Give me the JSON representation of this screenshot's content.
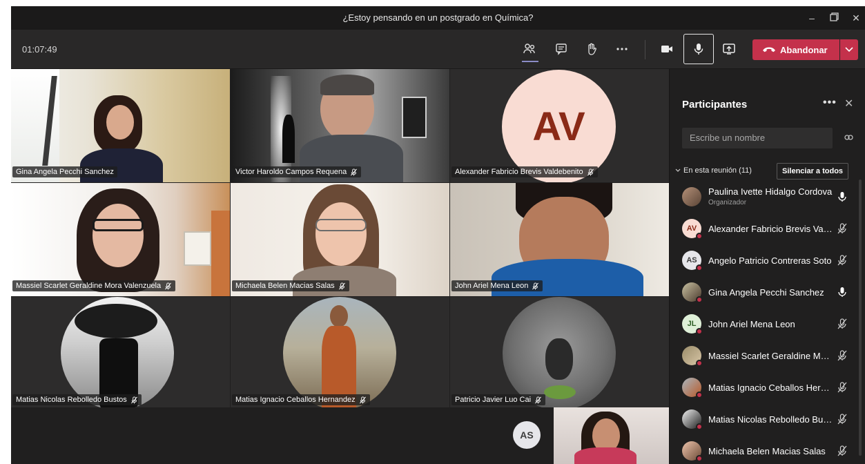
{
  "window": {
    "title": "¿Estoy pensando en un postgrado en Química?"
  },
  "toolbar": {
    "timer": "01:07:49",
    "leave_label": "Abandonar",
    "icons": [
      "people-icon",
      "chat-icon",
      "raise-hand-icon",
      "more-icon",
      "camera-icon",
      "microphone-icon",
      "share-screen-icon",
      "phone-hangup-icon",
      "chevron-down-icon"
    ]
  },
  "grid": {
    "tiles": [
      {
        "name": "Gina Angela Pecchi Sanchez",
        "muted": false
      },
      {
        "name": "Victor Haroldo Campos Requena",
        "muted": true
      },
      {
        "name": "Alexander Fabricio Brevis Valdebenito",
        "muted": true,
        "initials": "AV"
      },
      {
        "name": "Massiel Scarlet Geraldine Mora Valenzuela",
        "muted": true
      },
      {
        "name": "Michaela Belen Macias Salas",
        "muted": true
      },
      {
        "name": "John Ariel Mena Leon",
        "muted": true
      },
      {
        "name": "Matias Nicolas Rebolledo Bustos",
        "muted": true
      },
      {
        "name": "Matias Ignacio Ceballos Hernandez",
        "muted": true
      },
      {
        "name": "Patricio Javier Luo Cai",
        "muted": true
      }
    ],
    "overflow_initials": "AS"
  },
  "panel": {
    "title": "Participantes",
    "search_placeholder": "Escribe un nombre",
    "section_label": "En esta reunión (11)",
    "mute_all_label": "Silenciar a todos",
    "participants": [
      {
        "name": "Paulina Ivette Hidalgo Cordova",
        "role": "Organizador",
        "initials": "",
        "mic": "on"
      },
      {
        "name": "Alexander Fabricio Brevis Vald...",
        "role": "",
        "initials": "AV",
        "mic": "off"
      },
      {
        "name": "Angelo Patricio Contreras Soto",
        "role": "",
        "initials": "AS",
        "mic": "off"
      },
      {
        "name": "Gina Angela Pecchi Sanchez",
        "role": "",
        "initials": "",
        "mic": "on"
      },
      {
        "name": "John Ariel Mena Leon",
        "role": "",
        "initials": "JL",
        "mic": "off"
      },
      {
        "name": "Massiel Scarlet Geraldine Mor...",
        "role": "",
        "initials": "",
        "mic": "off"
      },
      {
        "name": "Matias Ignacio Ceballos Hern...",
        "role": "",
        "initials": "",
        "mic": "off"
      },
      {
        "name": "Matias Nicolas Rebolledo Bus...",
        "role": "",
        "initials": "",
        "mic": "off"
      },
      {
        "name": "Michaela Belen Macias Salas",
        "role": "",
        "initials": "",
        "mic": "off"
      }
    ]
  },
  "colors": {
    "accent": "#c4314b",
    "background": "#201f1f",
    "panel": "#201f1f",
    "avatar_av": "#f9dcd3",
    "avatar_text": "#8a2a17"
  }
}
